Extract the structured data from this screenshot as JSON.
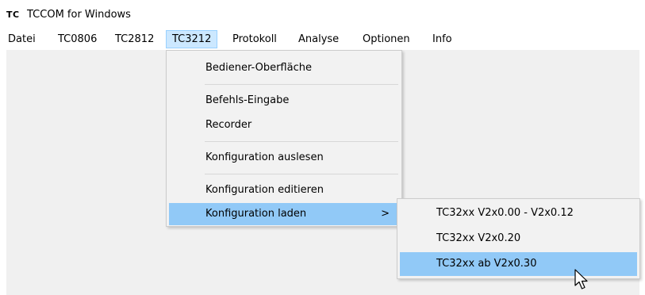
{
  "window": {
    "icon_text": "TC",
    "title": "TCCOM for Windows"
  },
  "menubar": {
    "items": [
      {
        "label": "Datei"
      },
      {
        "label": "TC0806"
      },
      {
        "label": "TC2812"
      },
      {
        "label": "TC3212",
        "active": true
      },
      {
        "label": "Protokoll"
      },
      {
        "label": "Analyse"
      },
      {
        "label": "Optionen"
      },
      {
        "label": "Info"
      }
    ]
  },
  "dropdown": {
    "items": [
      {
        "label": "Bediener-Oberfläche"
      },
      {
        "label": "Befehls-Eingabe"
      },
      {
        "label": "Recorder"
      },
      {
        "label": "Konfiguration auslesen"
      },
      {
        "label": "Konfiguration editieren"
      },
      {
        "label": "Konfiguration laden",
        "highlighted": true,
        "submenu_arrow": ">"
      }
    ]
  },
  "submenu": {
    "items": [
      {
        "label": "TC32xx V2x0.00 - V2x0.12"
      },
      {
        "label": "TC32xx V2x0.20"
      },
      {
        "label": "TC32xx ab V2x0.30",
        "highlighted": true
      }
    ]
  },
  "colors": {
    "client_bg": "#f0f0f0",
    "menu_bg": "#f2f2f2",
    "highlight": "#91c9f7",
    "menubar_active": "#cce8ff"
  },
  "icons": {
    "cursor": "mouse-pointer-icon"
  }
}
